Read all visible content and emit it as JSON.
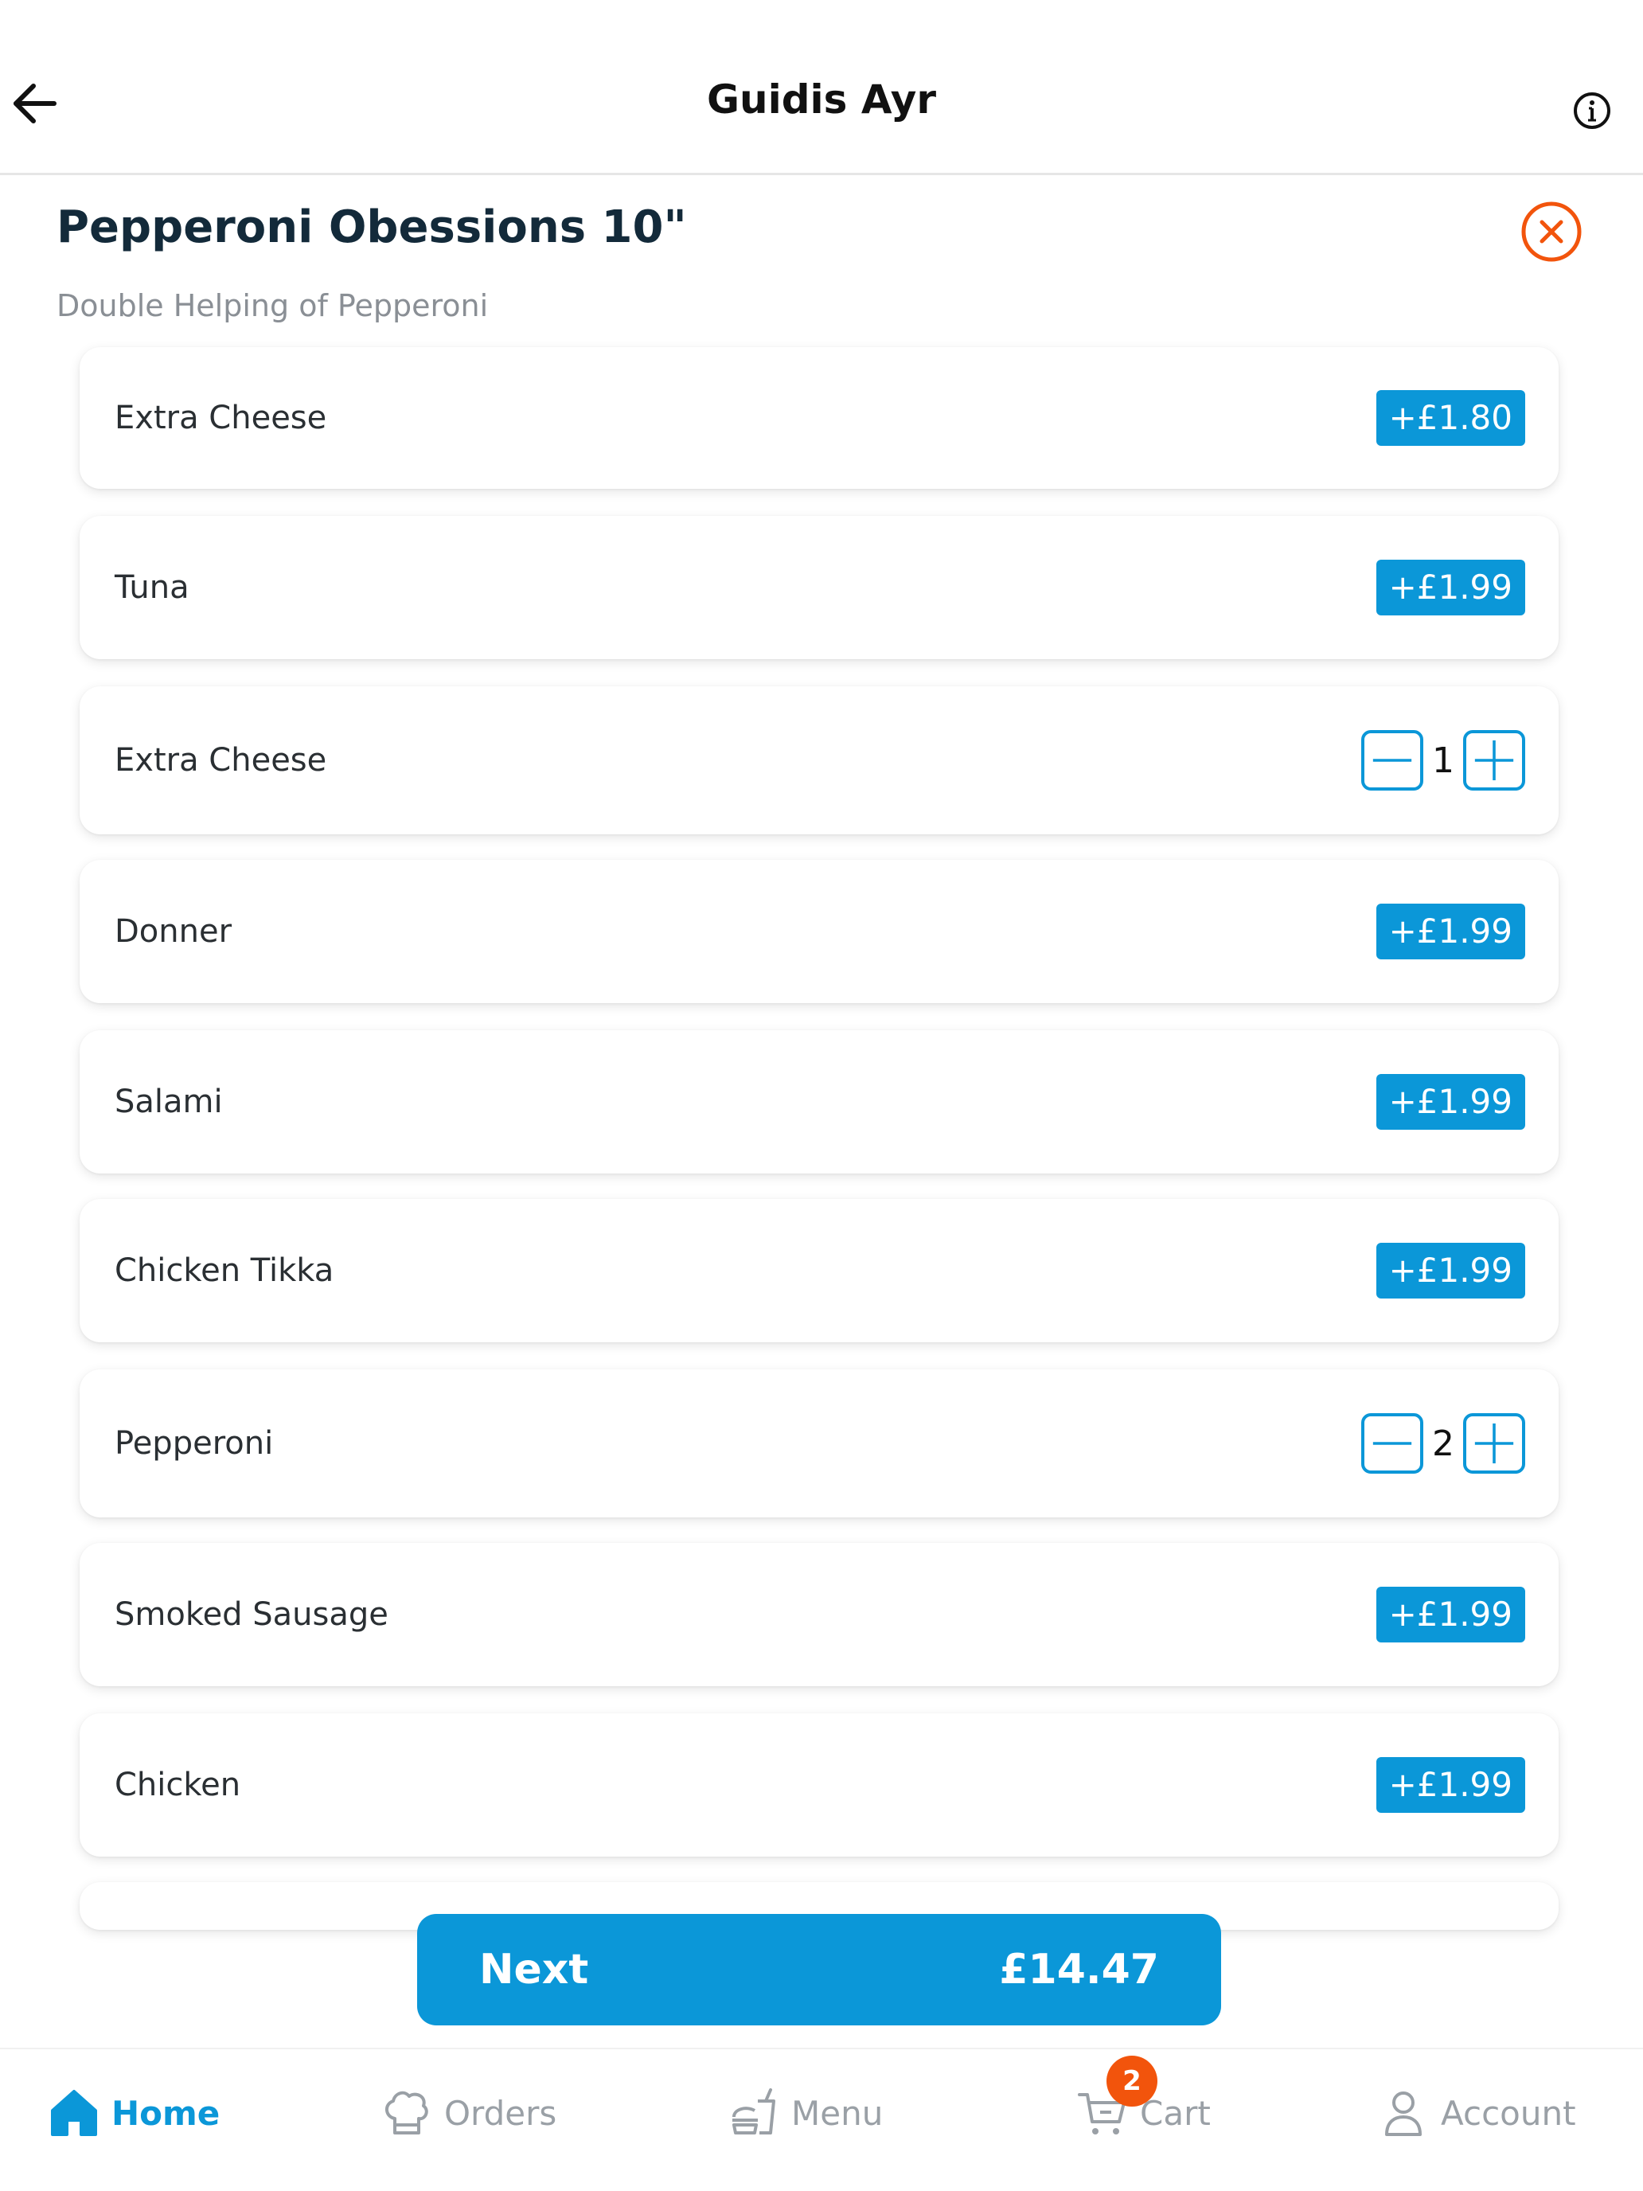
{
  "header": {
    "title": "Guidis Ayr"
  },
  "item": {
    "title": "Pepperoni Obessions 10\"",
    "description": "Double Helping of Pepperoni"
  },
  "options": [
    {
      "label": "Extra Cheese",
      "price": "+£1.80"
    },
    {
      "label": "Tuna",
      "price": "+£1.99"
    },
    {
      "label": "Extra Cheese",
      "quantity": "1"
    },
    {
      "label": "Donner",
      "price": "+£1.99"
    },
    {
      "label": "Salami",
      "price": "+£1.99"
    },
    {
      "label": "Chicken Tikka",
      "price": "+£1.99"
    },
    {
      "label": "Pepperoni",
      "quantity": "2"
    },
    {
      "label": "Smoked Sausage",
      "price": "+£1.99"
    },
    {
      "label": "Chicken",
      "price": "+£1.99"
    }
  ],
  "next_button": {
    "label": "Next",
    "total": "£14.47"
  },
  "bottom_nav": {
    "home": "Home",
    "orders": "Orders",
    "menu": "Menu",
    "cart": "Cart",
    "cart_badge": "2",
    "account": "Account"
  },
  "colors": {
    "accent": "#0b97d8",
    "close": "#f2540c",
    "badge": "#f2540c"
  },
  "icons": {
    "back": "arrow-left-icon",
    "info": "info-icon",
    "close": "close-circle-icon",
    "home": "home-icon",
    "orders": "chef-hat-icon",
    "menu": "burger-drink-icon",
    "cart": "cart-icon",
    "account": "user-icon"
  }
}
